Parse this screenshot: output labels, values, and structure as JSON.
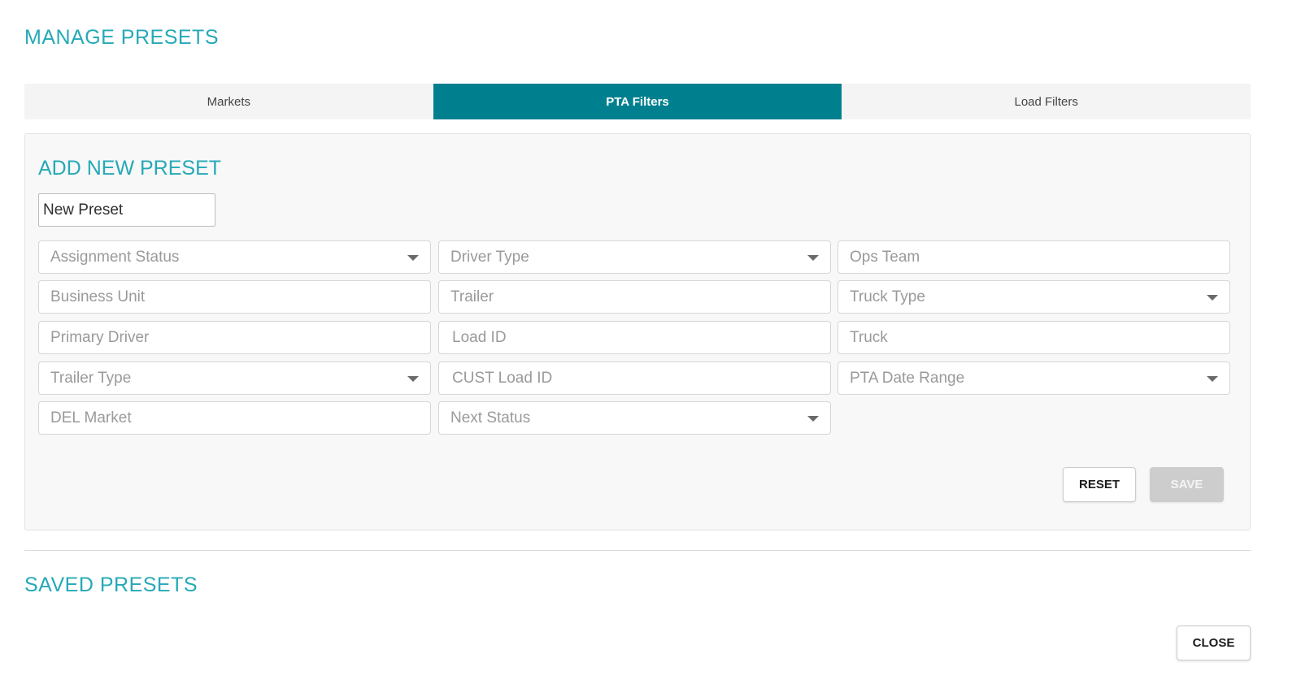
{
  "header": {
    "title": "MANAGE PRESETS"
  },
  "tabs": [
    {
      "label": "Markets",
      "active": false
    },
    {
      "label": "PTA Filters",
      "active": true
    },
    {
      "label": "Load Filters",
      "active": false
    }
  ],
  "add_preset": {
    "title": "ADD NEW PRESET",
    "name_value": "New Preset",
    "fields": {
      "assignment_status": {
        "placeholder": "Assignment Status",
        "type": "select"
      },
      "driver_type": {
        "placeholder": "Driver Type",
        "type": "select"
      },
      "ops_team": {
        "placeholder": "Ops Team",
        "type": "text"
      },
      "business_unit": {
        "placeholder": "Business Unit",
        "type": "text"
      },
      "trailer": {
        "placeholder": "Trailer",
        "type": "text"
      },
      "truck_type": {
        "placeholder": "Truck Type",
        "type": "select"
      },
      "primary_driver": {
        "placeholder": "Primary Driver",
        "type": "text"
      },
      "load_id": {
        "placeholder": "Load ID",
        "type": "text"
      },
      "truck": {
        "placeholder": "Truck",
        "type": "text"
      },
      "trailer_type": {
        "placeholder": "Trailer Type",
        "type": "select"
      },
      "cust_load_id": {
        "placeholder": "CUST Load ID",
        "type": "text"
      },
      "pta_date_range": {
        "placeholder": "PTA Date Range",
        "type": "select"
      },
      "del_market": {
        "placeholder": "DEL Market",
        "type": "text"
      },
      "next_status": {
        "placeholder": "Next Status",
        "type": "select"
      }
    },
    "buttons": {
      "reset": "RESET",
      "save": "SAVE"
    }
  },
  "saved_presets": {
    "title": "SAVED PRESETS"
  },
  "footer": {
    "close": "CLOSE"
  },
  "colors": {
    "accent": "#25a9b7",
    "tab_active": "#00808f",
    "disabled_button": "#cdcdcd"
  }
}
